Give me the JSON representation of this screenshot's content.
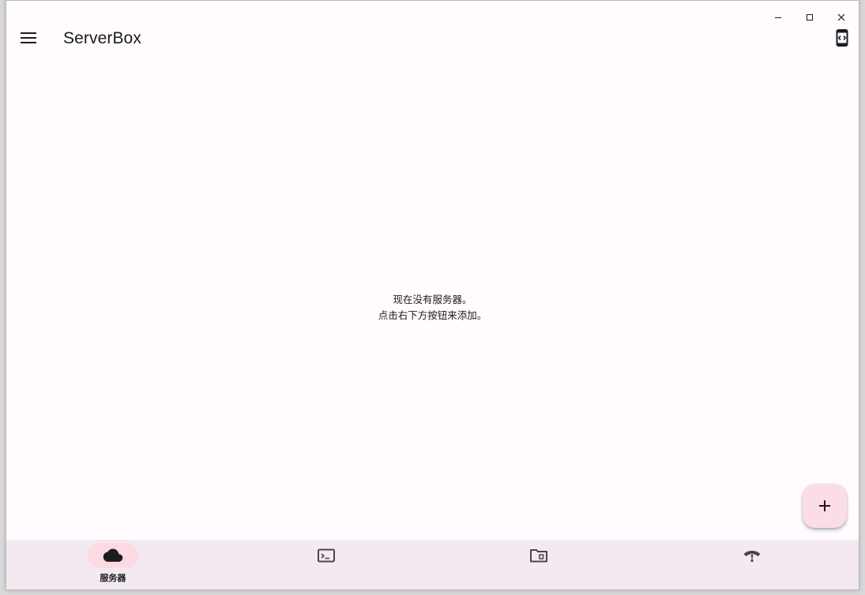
{
  "app": {
    "title": "ServerBox"
  },
  "window_controls": {
    "minimize_icon": "minimize-icon",
    "maximize_icon": "maximize-icon",
    "close_icon": "close-icon"
  },
  "appbar": {
    "menu_icon": "menu-icon",
    "action_icon": "code-braces-icon"
  },
  "main": {
    "empty_line1": "现在没有服务器。",
    "empty_line2": "点击右下方按钮来添加。"
  },
  "fab": {
    "icon": "plus-icon"
  },
  "navbar": {
    "items": [
      {
        "label": "服务器",
        "icon": "cloud-icon",
        "active": true
      },
      {
        "label": "",
        "icon": "terminal-icon",
        "active": false
      },
      {
        "label": "",
        "icon": "folder-icon",
        "active": false
      },
      {
        "label": "",
        "icon": "network-icon",
        "active": false
      }
    ]
  },
  "colors": {
    "background": "#fffbff",
    "navbar": "#f4e9f1",
    "active_indicator": "#fcd9e3",
    "fab": "#fbdde6",
    "text": "#1c1b1f"
  }
}
